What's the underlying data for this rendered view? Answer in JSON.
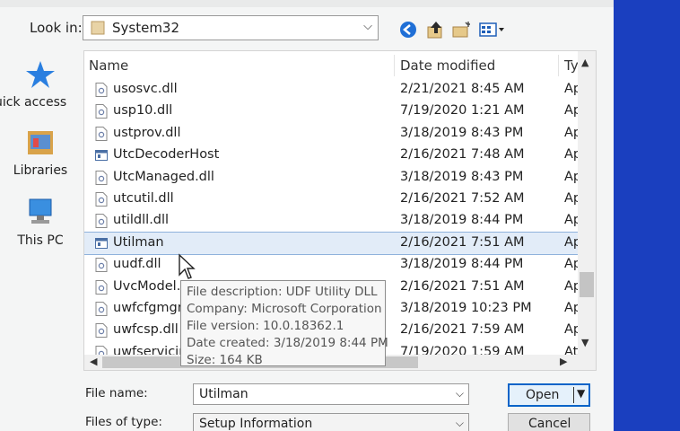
{
  "lookin": {
    "label": "Look in:",
    "value": "System32"
  },
  "toolbar": {
    "icons": [
      "back-icon",
      "up-folder-icon",
      "new-folder-icon",
      "view-menu-icon"
    ]
  },
  "places": [
    {
      "label": "uick access",
      "icon": "star-icon"
    },
    {
      "label": "Libraries",
      "icon": "libraries-icon"
    },
    {
      "label": "This PC",
      "icon": "computer-icon"
    }
  ],
  "columns": {
    "name": "Name",
    "date": "Date modified",
    "type": "Ty"
  },
  "files": [
    {
      "name": "usosvc.dll",
      "date": "2/21/2021 8:45 AM",
      "type": "Ap",
      "icon": "dll-icon"
    },
    {
      "name": "usp10.dll",
      "date": "7/19/2020 1:21 AM",
      "type": "Ap",
      "icon": "dll-icon"
    },
    {
      "name": "ustprov.dll",
      "date": "3/18/2019 8:43 PM",
      "type": "Ap",
      "icon": "dll-icon"
    },
    {
      "name": "UtcDecoderHost",
      "date": "2/16/2021 7:48 AM",
      "type": "Ap",
      "icon": "exe-icon"
    },
    {
      "name": "UtcManaged.dll",
      "date": "3/18/2019 8:43 PM",
      "type": "Ap",
      "icon": "dll-icon"
    },
    {
      "name": "utcutil.dll",
      "date": "2/16/2021 7:52 AM",
      "type": "Ap",
      "icon": "dll-icon"
    },
    {
      "name": "utildll.dll",
      "date": "3/18/2019 8:44 PM",
      "type": "Ap",
      "icon": "dll-icon"
    },
    {
      "name": "Utilman",
      "date": "2/16/2021 7:51 AM",
      "type": "Ap",
      "icon": "exe-icon",
      "selected": true
    },
    {
      "name": "uudf.dll",
      "date": "3/18/2019 8:44 PM",
      "type": "Ap",
      "icon": "dll-icon"
    },
    {
      "name": "UvcModel.d",
      "date": "2/16/2021 7:51 AM",
      "type": "Ap",
      "icon": "dll-icon"
    },
    {
      "name": "uwfcfgmgn",
      "date": "3/18/2019 10:23 PM",
      "type": "Ap",
      "icon": "dll-icon"
    },
    {
      "name": "uwfcsp.dll",
      "date": "2/16/2021 7:59 AM",
      "type": "Ap",
      "icon": "dll-icon"
    },
    {
      "name": "uwfservicin",
      "date": "7/19/2020 1:59 AM",
      "type": "At",
      "icon": "dll-icon"
    }
  ],
  "tooltip": [
    "File description: UDF Utility DLL",
    "Company: Microsoft Corporation",
    "File version: 10.0.18362.1",
    "Date created: 3/18/2019 8:44 PM",
    "Size: 164 KB"
  ],
  "filename": {
    "label": "File name:",
    "value": "Utilman"
  },
  "filetype": {
    "label": "Files of type:",
    "value": "Setup Information"
  },
  "buttons": {
    "open": "Open",
    "cancel": "Cancel"
  },
  "colors": {
    "accent": "#0a64c8",
    "selection": "#e2ecf8",
    "desktop": "#1a3fbf"
  }
}
